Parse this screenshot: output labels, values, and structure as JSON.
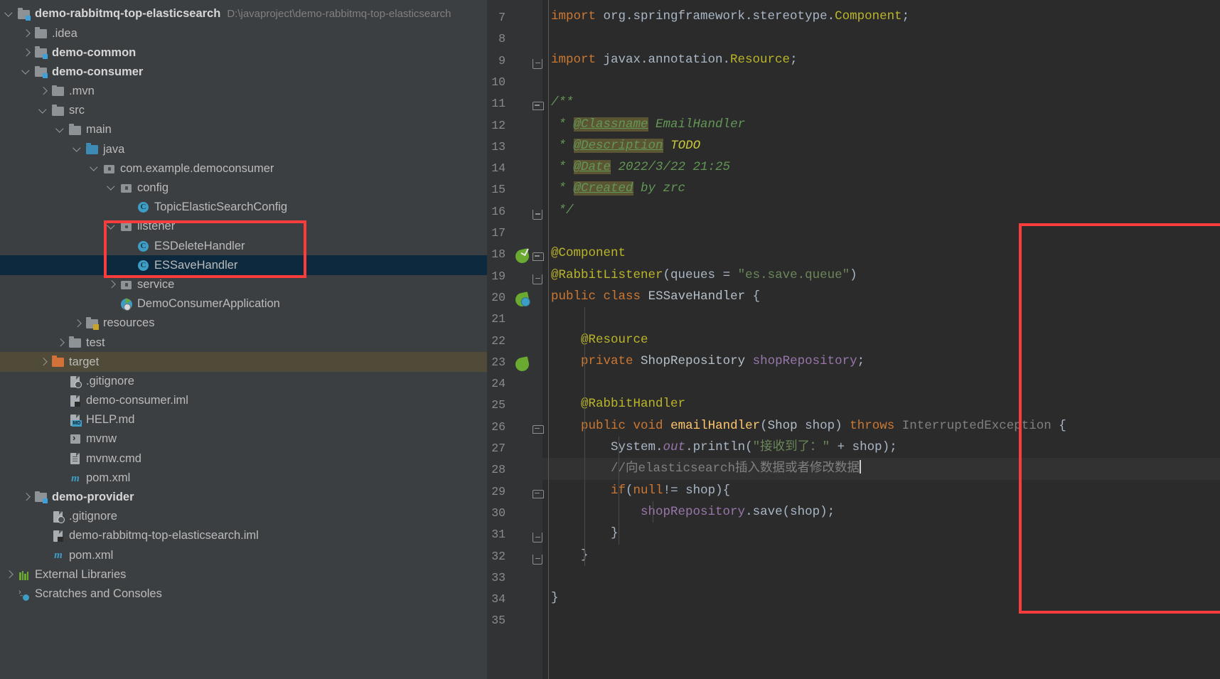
{
  "window": {
    "theme_bg": "#3c3f41",
    "editor_bg": "#2b2b2b",
    "accent_red": "#fa3c3c",
    "selection_blue": "#0d293e",
    "excluded_olive": "#4f4b38"
  },
  "project_tree": {
    "root_label": "demo-rabbitmq-top-elasticsearch",
    "root_path": "D:\\javaproject\\demo-rabbitmq-top-elasticsearch",
    "items": [
      {
        "label": ".idea",
        "icon": "folder-icon",
        "indent": 1,
        "arrow": "right",
        "bold": false,
        "state": "normal"
      },
      {
        "label": "demo-common",
        "icon": "module-folder-icon",
        "indent": 1,
        "arrow": "right",
        "bold": true,
        "state": "normal"
      },
      {
        "label": "demo-consumer",
        "icon": "module-folder-icon",
        "indent": 1,
        "arrow": "down",
        "bold": true,
        "state": "normal"
      },
      {
        "label": ".mvn",
        "icon": "folder-icon",
        "indent": 2,
        "arrow": "right",
        "bold": false,
        "state": "normal"
      },
      {
        "label": "src",
        "icon": "folder-icon",
        "indent": 2,
        "arrow": "down",
        "bold": false,
        "state": "normal"
      },
      {
        "label": "main",
        "icon": "folder-icon",
        "indent": 3,
        "arrow": "down",
        "bold": false,
        "state": "normal"
      },
      {
        "label": "java",
        "icon": "source-folder-icon",
        "indent": 4,
        "arrow": "down",
        "bold": false,
        "state": "normal"
      },
      {
        "label": "com.example.democonsumer",
        "icon": "package-icon",
        "indent": 5,
        "arrow": "down",
        "bold": false,
        "state": "normal"
      },
      {
        "label": "config",
        "icon": "package-icon",
        "indent": 6,
        "arrow": "down",
        "bold": false,
        "state": "normal"
      },
      {
        "label": "TopicElasticSearchConfig",
        "icon": "java-class-icon",
        "indent": 7,
        "arrow": "none",
        "bold": false,
        "state": "normal"
      },
      {
        "label": "listener",
        "icon": "package-icon",
        "indent": 6,
        "arrow": "down",
        "bold": false,
        "state": "normal"
      },
      {
        "label": "ESDeleteHandler",
        "icon": "java-class-icon",
        "indent": 7,
        "arrow": "none",
        "bold": false,
        "state": "normal"
      },
      {
        "label": "ESSaveHandler",
        "icon": "java-class-icon",
        "indent": 7,
        "arrow": "none",
        "bold": false,
        "state": "selected"
      },
      {
        "label": "service",
        "icon": "package-icon",
        "indent": 6,
        "arrow": "right",
        "bold": false,
        "state": "normal"
      },
      {
        "label": "DemoConsumerApplication",
        "icon": "spring-boot-app-icon",
        "indent": 6,
        "arrow": "none",
        "bold": false,
        "state": "normal"
      },
      {
        "label": "resources",
        "icon": "resources-folder-icon",
        "indent": 4,
        "arrow": "right",
        "bold": false,
        "state": "normal"
      },
      {
        "label": "test",
        "icon": "test-folder-icon",
        "indent": 3,
        "arrow": "right",
        "bold": false,
        "state": "normal"
      },
      {
        "label": "target",
        "icon": "excluded-folder-icon",
        "indent": 2,
        "arrow": "right",
        "bold": false,
        "state": "excluded"
      },
      {
        "label": ".gitignore",
        "icon": "gitignore-file-icon",
        "indent": 3,
        "arrow": "none",
        "bold": false,
        "state": "normal"
      },
      {
        "label": "demo-consumer.iml",
        "icon": "iml-file-icon",
        "indent": 3,
        "arrow": "none",
        "bold": false,
        "state": "normal"
      },
      {
        "label": "HELP.md",
        "icon": "markdown-file-icon",
        "indent": 3,
        "arrow": "none",
        "bold": false,
        "state": "normal"
      },
      {
        "label": "mvnw",
        "icon": "shell-script-icon",
        "indent": 3,
        "arrow": "none",
        "bold": false,
        "state": "normal"
      },
      {
        "label": "mvnw.cmd",
        "icon": "text-file-icon",
        "indent": 3,
        "arrow": "none",
        "bold": false,
        "state": "normal"
      },
      {
        "label": "pom.xml",
        "icon": "maven-pom-icon",
        "indent": 3,
        "arrow": "none",
        "bold": false,
        "state": "normal"
      },
      {
        "label": "demo-provider",
        "icon": "module-folder-icon",
        "indent": 1,
        "arrow": "right",
        "bold": true,
        "state": "normal"
      },
      {
        "label": ".gitignore",
        "icon": "gitignore-file-icon",
        "indent": 2,
        "arrow": "none",
        "bold": false,
        "state": "normal"
      },
      {
        "label": "demo-rabbitmq-top-elasticsearch.iml",
        "icon": "iml-file-icon",
        "indent": 2,
        "arrow": "none",
        "bold": false,
        "state": "normal"
      },
      {
        "label": "pom.xml",
        "icon": "maven-pom-icon",
        "indent": 2,
        "arrow": "none",
        "bold": false,
        "state": "normal"
      },
      {
        "label": "External Libraries",
        "icon": "external-libraries-icon",
        "indent": 0,
        "arrow": "right",
        "bold": false,
        "state": "normal"
      },
      {
        "label": "Scratches and Consoles",
        "icon": "scratches-icon",
        "indent": 0,
        "arrow": "none",
        "bold": false,
        "state": "normal"
      }
    ]
  },
  "editor": {
    "first_visible_line": 7,
    "last_visible_line": 35,
    "cursor_line": 28,
    "gutter_icons": [
      {
        "line": 18,
        "icon": "spring-bean-check-icon"
      },
      {
        "line": 20,
        "icon": "spring-bean-icon"
      },
      {
        "line": 23,
        "icon": "spring-autowired-arrow-icon"
      }
    ],
    "lines": [
      {
        "n": 7,
        "text": "import org.springframework.stereotype.Component;"
      },
      {
        "n": 8,
        "text": ""
      },
      {
        "n": 9,
        "text": "import javax.annotation.Resource;"
      },
      {
        "n": 10,
        "text": ""
      },
      {
        "n": 11,
        "text": "/**"
      },
      {
        "n": 12,
        "text": " * @Classname EmailHandler"
      },
      {
        "n": 13,
        "text": " * @Description TODO"
      },
      {
        "n": 14,
        "text": " * @Date 2022/3/22 21:25"
      },
      {
        "n": 15,
        "text": " * @Created by zrc"
      },
      {
        "n": 16,
        "text": " */"
      },
      {
        "n": 17,
        "text": ""
      },
      {
        "n": 18,
        "text": "@Component"
      },
      {
        "n": 19,
        "text": "@RabbitListener(queues = \"es.save.queue\")"
      },
      {
        "n": 20,
        "text": "public class ESSaveHandler {"
      },
      {
        "n": 21,
        "text": ""
      },
      {
        "n": 22,
        "text": "    @Resource"
      },
      {
        "n": 23,
        "text": "    private ShopRepository shopRepository;"
      },
      {
        "n": 24,
        "text": ""
      },
      {
        "n": 25,
        "text": "    @RabbitHandler"
      },
      {
        "n": 26,
        "text": "    public void emailHandler(Shop shop) throws InterruptedException {"
      },
      {
        "n": 27,
        "text": "        System.out.println(\"接收到了：\" + shop);"
      },
      {
        "n": 28,
        "text": "        //向elasticsearch插入数据或者修改数据"
      },
      {
        "n": 29,
        "text": "        if(null!= shop){"
      },
      {
        "n": 30,
        "text": "            shopRepository.save(shop);"
      },
      {
        "n": 31,
        "text": "        }"
      },
      {
        "n": 32,
        "text": "    }"
      },
      {
        "n": 33,
        "text": ""
      },
      {
        "n": 34,
        "text": "}"
      },
      {
        "n": 35,
        "text": ""
      }
    ],
    "javadoc": {
      "classname_tag": "@Classname",
      "classname_value": "EmailHandler",
      "description_tag": "@Description",
      "description_value": "TODO",
      "date_tag": "@Date",
      "date_value": "2022/3/22 21:25",
      "created_tag": "@Created",
      "created_value": "by zrc"
    },
    "class_name": "ESSaveHandler",
    "queue_name": "es.save.queue",
    "method_name": "emailHandler",
    "field_name": "shopRepository",
    "field_type": "ShopRepository",
    "print_text": "接收到了：",
    "comment_text": "//向elasticsearch插入数据或者修改数据"
  },
  "annotations": {
    "tree_box_label": "listener-package-highlight",
    "editor_box_label": "essavehandler-class-highlight"
  }
}
